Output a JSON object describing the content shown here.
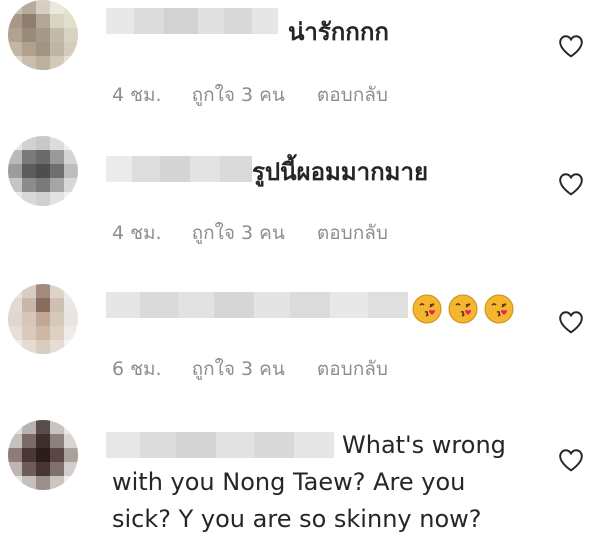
{
  "comments": [
    {
      "text": "น่ารักกกก",
      "time": "4 ชม.",
      "likes": "ถูกใจ 3 คน",
      "reply": "ตอบกลับ"
    },
    {
      "text": "รูปนี้ผอมมากมาย",
      "time": "4 ชม.",
      "likes": "ถูกใจ 3 คน",
      "reply": "ตอบกลับ"
    },
    {
      "text": "",
      "time": "6 ชม.",
      "likes": "ถูกใจ 3 คน",
      "reply": "ตอบกลับ",
      "emoji_count": 3,
      "emoji_icon": "kissing-face-emoji"
    },
    {
      "text_line1": "What's wrong",
      "text_line2": "with you Nong Taew? Are you",
      "text_line3": "sick? Y you are so skinny now?"
    }
  ],
  "icons": {
    "like": "heart-outline-icon"
  },
  "colors": {
    "meta": "#8e8e8e",
    "text": "#262626",
    "emoji": "#f5b52e"
  }
}
